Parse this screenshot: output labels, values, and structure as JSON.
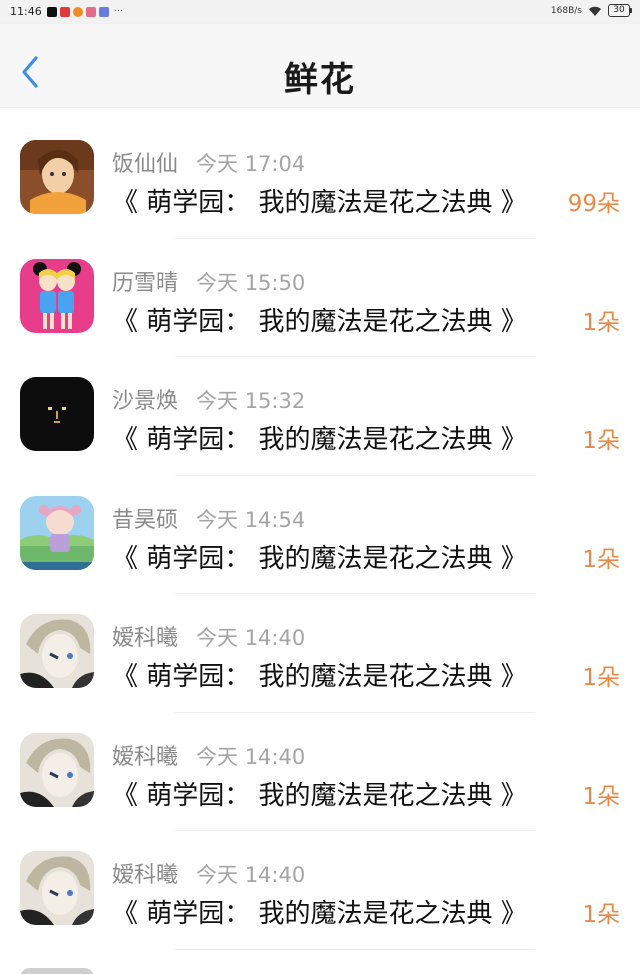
{
  "status_bar": {
    "time": "11:46",
    "app_icons": [
      {
        "icon": "tiktok-icon",
        "color": "#111111"
      },
      {
        "icon": "app-red-icon",
        "color": "#e03a3a"
      },
      {
        "icon": "app-orange-icon",
        "color": "#f08a24"
      },
      {
        "icon": "app-pink-icon",
        "color": "#e86a8a"
      },
      {
        "icon": "app-blue-icon",
        "color": "#6a7be0"
      }
    ],
    "more": "···",
    "speed": "168B/s",
    "battery": "30"
  },
  "header": {
    "title": "鲜花",
    "back_icon": "chevron-left-icon",
    "back_color": "#3a8ee6"
  },
  "rows": [
    {
      "sender": "饭仙仙",
      "time": "今天 17:04",
      "message": "《 萌学园： 我的魔法是花之法典 》",
      "amount": "99朵",
      "avatar": "anime-girl-orange-scarf"
    },
    {
      "sender": "历雪晴",
      "time": "今天 15:50",
      "message": "《 萌学园： 我的魔法是花之法典 》",
      "amount": "1朵",
      "avatar": "two-cartoon-girls-pink"
    },
    {
      "sender": "沙景焕",
      "time": "今天 15:32",
      "message": "《 萌学园： 我的魔法是花之法典 》",
      "amount": "1朵",
      "avatar": "black-face-minimal"
    },
    {
      "sender": "昔昊硕",
      "time": "今天 14:54",
      "message": "《 萌学园： 我的魔法是花之法典 》",
      "amount": "1朵",
      "avatar": "cartoon-character-landscape"
    },
    {
      "sender": "嫒科曦",
      "time": "今天 14:40",
      "message": "《 萌学园： 我的魔法是花之法典 》",
      "amount": "1朵",
      "avatar": "anime-boy-sketch"
    },
    {
      "sender": "嫒科曦",
      "time": "今天 14:40",
      "message": "《 萌学园： 我的魔法是花之法典 》",
      "amount": "1朵",
      "avatar": "anime-boy-sketch"
    },
    {
      "sender": "嫒科曦",
      "time": "今天 14:40",
      "message": "《 萌学园： 我的魔法是花之法典 》",
      "amount": "1朵",
      "avatar": "anime-boy-sketch"
    }
  ],
  "colors": {
    "accent_orange": "#e8894a",
    "name_gray": "#8a8a8a",
    "back_blue": "#3a8ee6"
  }
}
